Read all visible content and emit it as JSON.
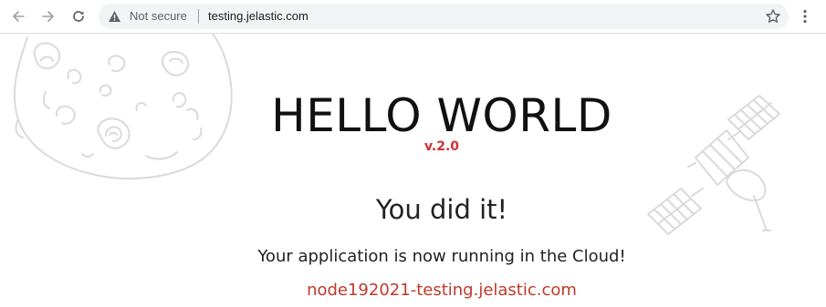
{
  "browser": {
    "back_icon": "arrow-left-icon",
    "forward_icon": "arrow-right-icon",
    "reload_icon": "reload-icon",
    "security_label": "Not secure",
    "url": "testing.jelastic.com",
    "bookmark_icon": "star-icon",
    "menu_icon": "kebab-menu-icon"
  },
  "page": {
    "title": "HELLO WORLD",
    "version": "v.2.0",
    "headline": "You did it!",
    "message": "Your application is now running in the Cloud!",
    "node_host": "node192021-testing.jelastic.com"
  },
  "colors": {
    "version": "#d32f2f",
    "node_host": "#c0392b",
    "illustration_stroke": "#d9dadc",
    "omnibox_bg": "#f1f3f4"
  }
}
